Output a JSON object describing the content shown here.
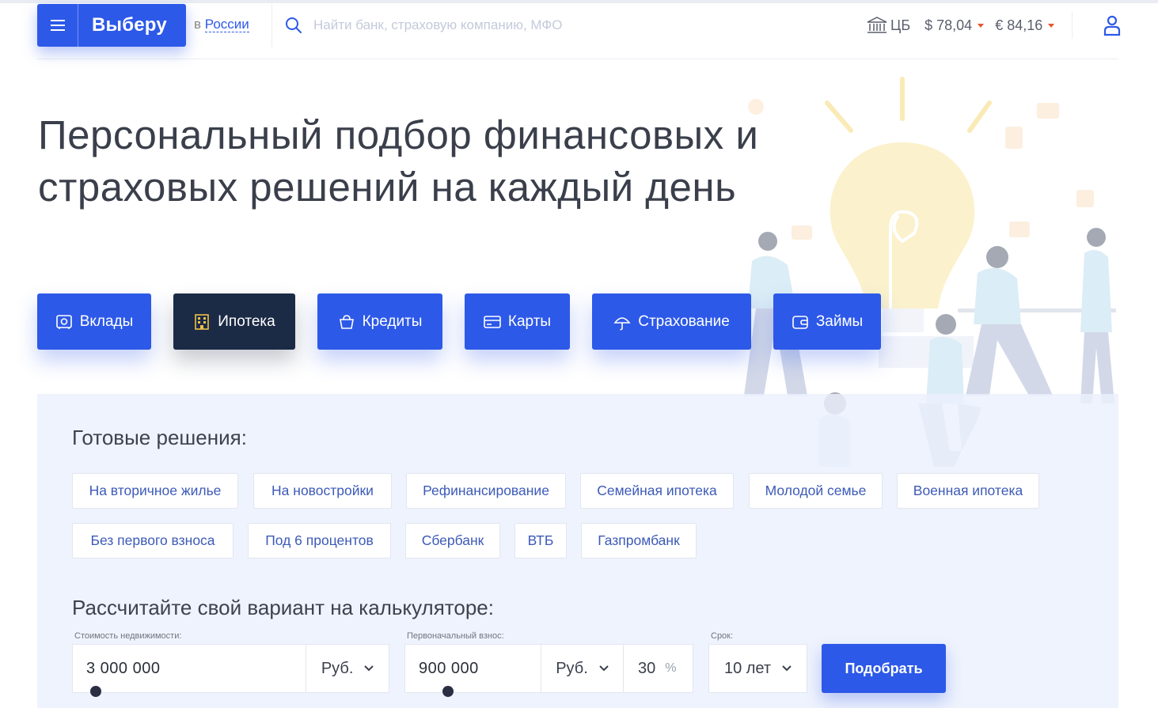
{
  "header": {
    "brand": "Выберу",
    "region_prefix": "в",
    "region_city": "России",
    "search_placeholder": "Найти банк, страховую компанию, МФО",
    "rates_source": "ЦБ",
    "usd": "$ 78,04",
    "eur": "€ 84,16"
  },
  "hero": {
    "title_line1": "Персональный подбор финансовых и",
    "title_line2": "страховых решений на каждый день"
  },
  "products": [
    {
      "label": "Вклады",
      "icon": "safe-icon",
      "active": false
    },
    {
      "label": "Ипотека",
      "icon": "building-icon",
      "active": true
    },
    {
      "label": "Кредиты",
      "icon": "basket-icon",
      "active": false
    },
    {
      "label": "Карты",
      "icon": "card-icon",
      "active": false
    },
    {
      "label": "Страхование",
      "icon": "umbrella-icon",
      "active": false
    },
    {
      "label": "Займы",
      "icon": "wallet-icon",
      "active": false
    }
  ],
  "solutions": {
    "title": "Готовые решения:",
    "row1": [
      "На вторичное жилье",
      "На новостройки",
      "Рефинансирование",
      "Семейная ипотека",
      "Молодой семье",
      "Военная ипотека"
    ],
    "row2": [
      "Без первого взноса",
      "Под 6 процентов",
      "Сбербанк",
      "ВТБ",
      "Газпромбанк"
    ]
  },
  "calculator": {
    "title": "Рассчитайте свой вариант на калькуляторе:",
    "cost_label": "Стоимость недвижимости:",
    "cost_value": "3 000 000",
    "cost_currency": "Руб.",
    "down_label": "Первоначальный взнос:",
    "down_value": "900 000",
    "down_currency": "Руб.",
    "down_percent": "30",
    "percent_sign": "%",
    "term_label": "Срок:",
    "term_value": "10 лет",
    "submit": "Подобрать"
  },
  "colors": {
    "accent": "#2d59e8",
    "dark": "#1b2a45",
    "panel": "#eef1fb"
  }
}
